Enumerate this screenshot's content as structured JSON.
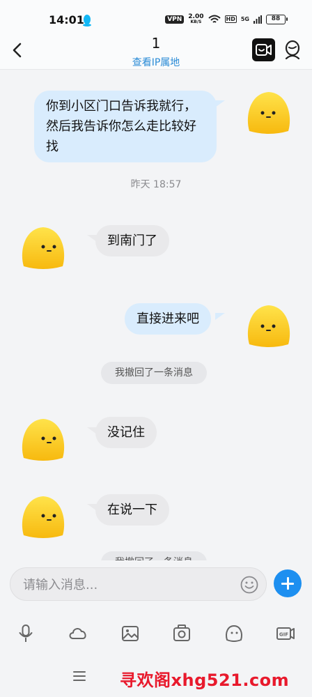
{
  "status_bar": {
    "time": "14:01",
    "vpn": "VPN",
    "speed": "2.00",
    "speed_unit": "KB/S",
    "hd": "HD",
    "signal": "5G",
    "battery": "88"
  },
  "header": {
    "title": "1",
    "subtitle": "查看IP属地"
  },
  "messages": [
    {
      "type": "sent",
      "text": "你到小区门口告诉我就行，然后我告诉你怎么走比较好找"
    },
    {
      "type": "time",
      "text": "昨天 18:57"
    },
    {
      "type": "received",
      "text": "到南门了"
    },
    {
      "type": "sent",
      "text": "直接进来吧"
    },
    {
      "type": "notice",
      "text": "我撤回了一条消息"
    },
    {
      "type": "received",
      "text": "没记住"
    },
    {
      "type": "received",
      "text": "在说一下"
    }
  ],
  "composer": {
    "placeholder": "请输入消息..."
  },
  "toolbar": {
    "icons": [
      "microphone-icon",
      "cloud-icon",
      "image-icon",
      "camera-icon",
      "sticker-icon",
      "gif-icon"
    ],
    "gif_label": "GIF"
  },
  "watermark": "寻欢阁xhg521.com",
  "colors": {
    "sent_bubble": "#d9ecfd",
    "received_bubble": "#e9e9eb",
    "accent": "#1d8ff0",
    "link": "#2a8bd6",
    "watermark": "#e8192c"
  }
}
